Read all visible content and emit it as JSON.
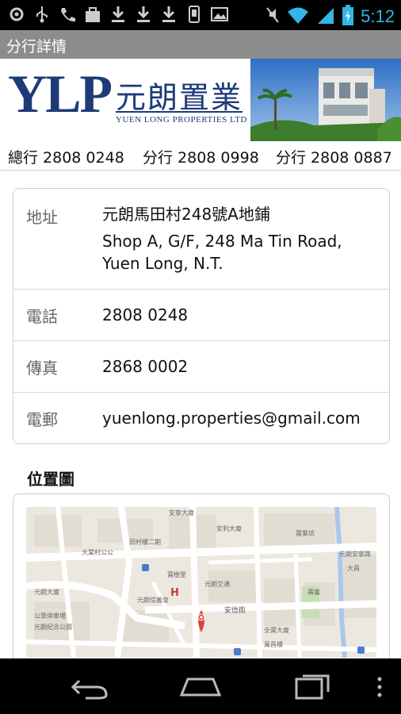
{
  "status_bar": {
    "time": "5:12",
    "icons_left": [
      "settings-icon",
      "usb-icon",
      "call-icon",
      "bag-icon",
      "download-icon",
      "download-icon",
      "download-icon",
      "phone-icon",
      "image-icon"
    ],
    "icons_right": [
      "mute-icon",
      "wifi-icon",
      "signal-icon",
      "battery-icon"
    ]
  },
  "titlebar": {
    "title": "分行詳情"
  },
  "banner": {
    "logo_letters": "YLP",
    "logo_chinese": "元朗置業",
    "logo_english": "YUEN LONG PROPERTIES LTD"
  },
  "phones": [
    "總行 2808 0248",
    "分行 2808 0998",
    "分行 2808 0887"
  ],
  "details": {
    "address_label": "地址",
    "address_zh": "元朗馬田村248號A地鋪",
    "address_en_1": "Shop A, G/F, 248 Ma Tin Road,",
    "address_en_2": "Yuen Long, N.T.",
    "phone_label": "電話",
    "phone_value": "2808 0248",
    "fax_label": "傳真",
    "fax_value": "2868 0002",
    "email_label": "電郵",
    "email_value": "yuenlong.properties@gmail.com"
  },
  "map_section": {
    "title": "位置圖",
    "map_labels": [
      "安寧大廈",
      "安利大廈",
      "寶業坊",
      "田村樓二期",
      "元朗交通",
      "寶樹里",
      "元朗信義會",
      "安信街",
      "全寶大廈",
      "萬昌樓",
      "壽富",
      "元朗安寧路",
      "大昌",
      "元朗大廈",
      "公眾停車場",
      "元朗紀念公園",
      "大棠村公公"
    ],
    "marker_icon": "map-marker-icon",
    "hospital_icon": "hospital-icon"
  },
  "colors": {
    "brand_navy": "#1e3b78",
    "title_bar": "#8c8c8c",
    "time_blue": "#33b5e5",
    "map_marker": "#e0413a"
  },
  "nav": {
    "buttons": [
      "back-icon",
      "home-icon",
      "recent-apps-icon",
      "menu-icon"
    ]
  }
}
